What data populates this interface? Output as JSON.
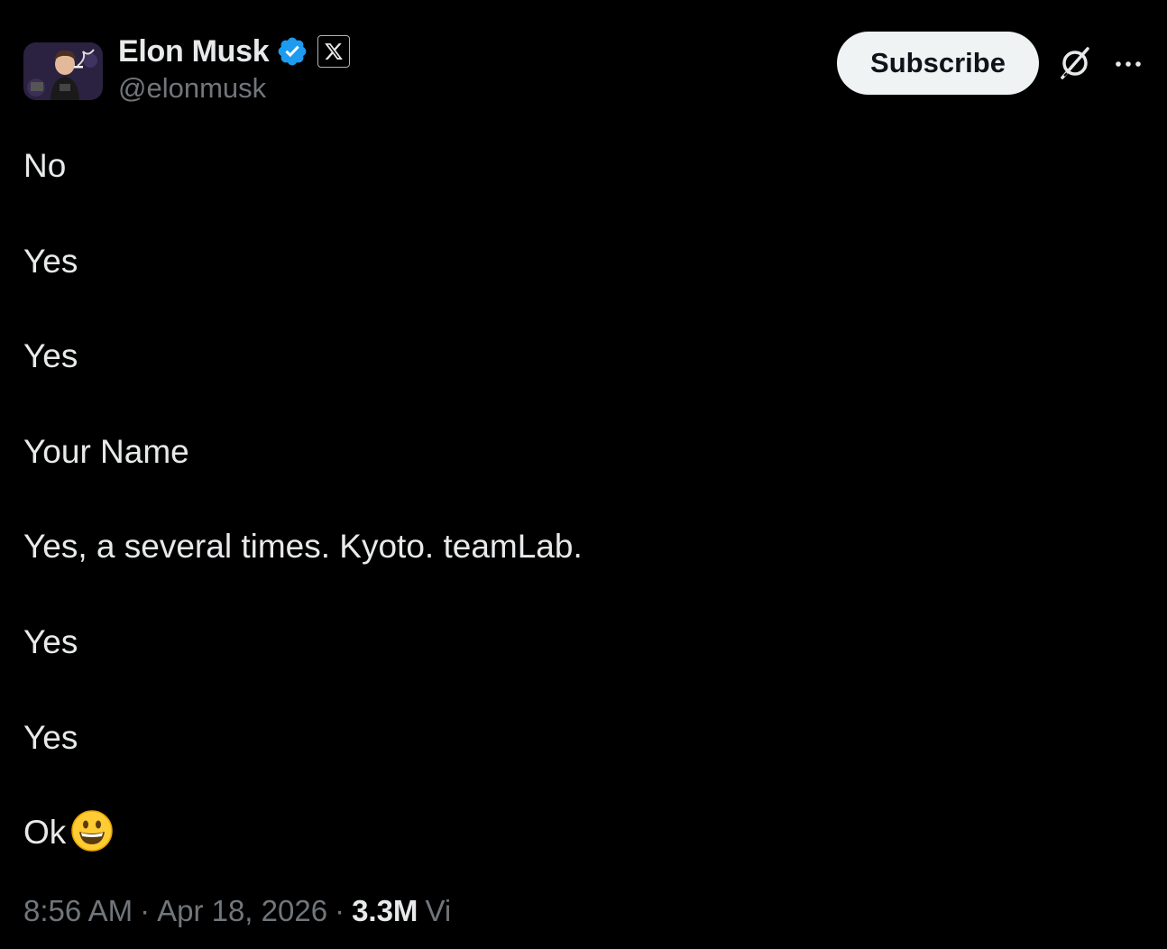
{
  "author": {
    "display_name": "Elon Musk",
    "handle": "@elonmusk",
    "avatar_icon": "avatar-image",
    "verified_icon": "verified-badge-icon",
    "affiliate_icon": "x-logo-icon"
  },
  "header": {
    "subscribe_label": "Subscribe",
    "grok_icon": "grok-icon",
    "more_icon": "more-horizontal-icon"
  },
  "tweet": {
    "lines": [
      "No",
      "Yes",
      "Yes",
      "Your Name",
      "Yes, a several times. Kyoto. teamLab.",
      "Yes",
      "Yes",
      "Ok"
    ],
    "last_line_emoji": "grinning-face-emoji"
  },
  "meta": {
    "time": "8:56 AM",
    "separator": "·",
    "date": "Apr 18, 2026",
    "views_count": "3.3M",
    "views_label": "Vi"
  },
  "colors": {
    "background": "#000000",
    "text_primary": "#e7e9ea",
    "text_secondary": "#71767b",
    "verified_blue": "#1d9bf0",
    "subscribe_bg": "#eff3f4"
  }
}
